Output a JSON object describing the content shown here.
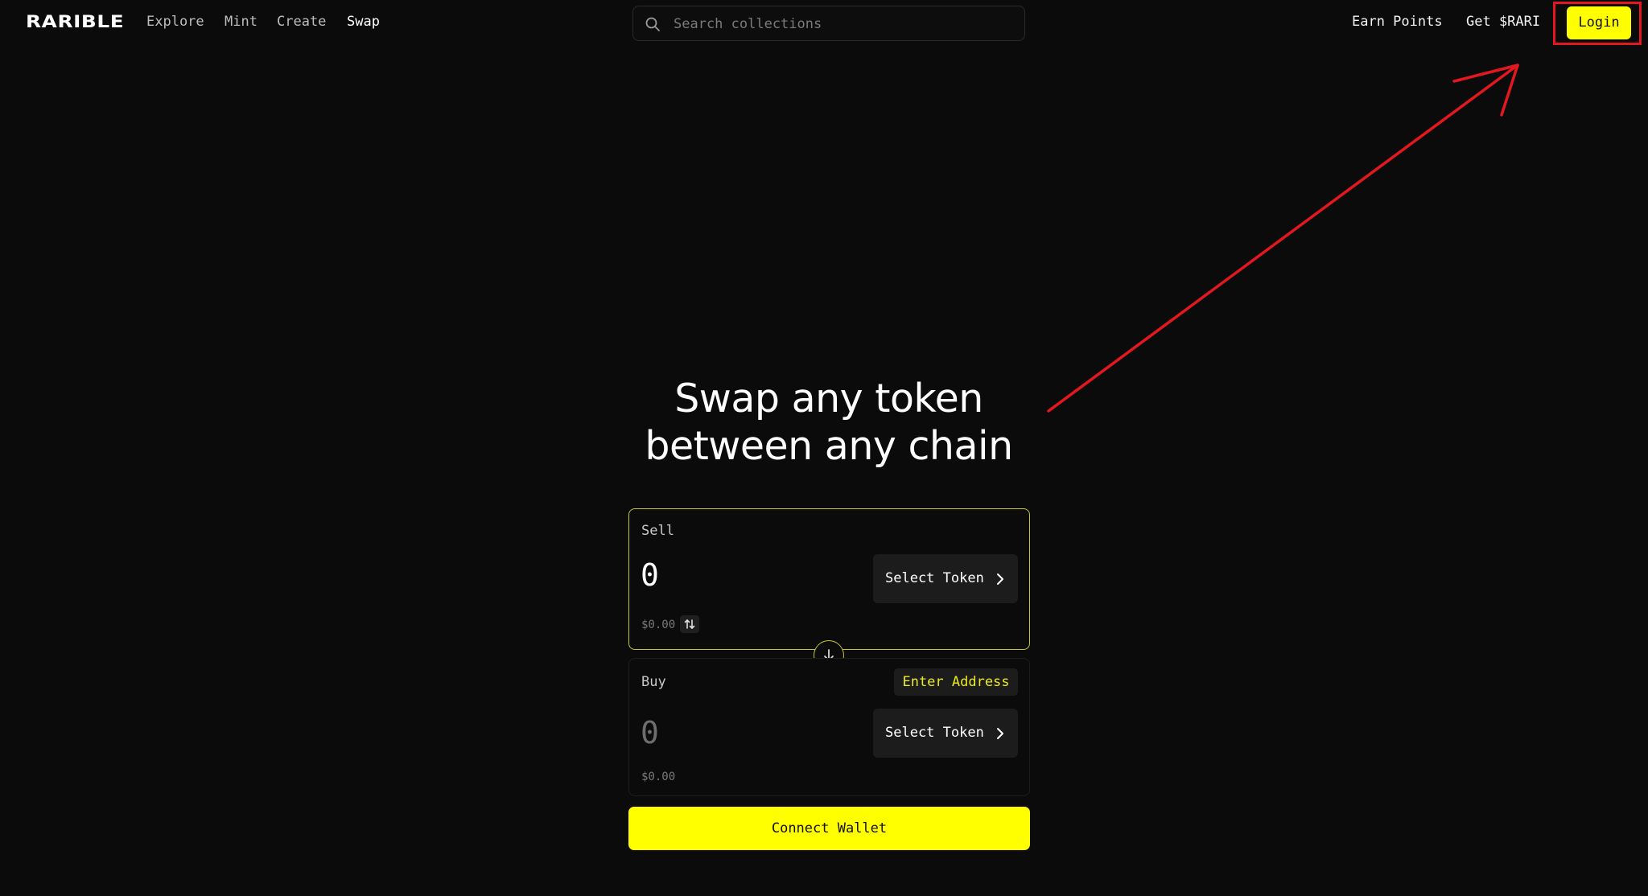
{
  "header": {
    "logo": "RARIBLE",
    "nav": [
      {
        "label": "Explore"
      },
      {
        "label": "Mint"
      },
      {
        "label": "Create"
      },
      {
        "label": "Swap"
      }
    ],
    "search": {
      "placeholder": "Search collections"
    },
    "earn_points": "Earn Points",
    "get_rari": "Get $RARI",
    "login": "Login"
  },
  "hero": {
    "line1": "Swap any token",
    "line2": "between any chain"
  },
  "sell": {
    "label": "Sell",
    "amount": "0",
    "usd_value": "$0.00",
    "select_token": "Select Token"
  },
  "buy": {
    "label": "Buy",
    "amount": "0",
    "usd_value": "$0.00",
    "enter_address": "Enter Address",
    "select_token": "Select Token"
  },
  "connect_wallet": "Connect Wallet",
  "colors": {
    "background": "#0b0b0b",
    "accent": "#ffff00",
    "annotation": "#e3181e"
  },
  "icons": {
    "search": "search-icon",
    "chevron": "chevron-right-icon",
    "flip": "arrow-down-icon",
    "swap_units": "swap-vertical-icon"
  }
}
